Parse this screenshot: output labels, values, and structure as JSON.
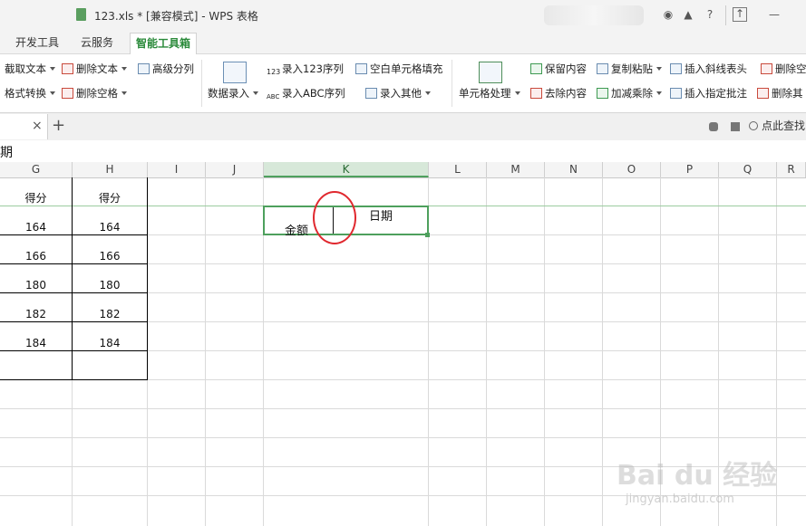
{
  "window": {
    "title": "123.xls * [兼容模式] - WPS 表格",
    "controls": [
      "?"
    ]
  },
  "ribbon_tabs": [
    {
      "label": "开发工具"
    },
    {
      "label": "云服务"
    },
    {
      "label": "智能工具箱",
      "active": true
    }
  ],
  "ribbon": {
    "extract_text": "截取文本",
    "delete_text": "删除文本",
    "advanced_split": "高级分列",
    "format_convert": "格式转换",
    "delete_spaces": "删除空格",
    "data_entry": "数据录入",
    "enter_123_seq": "录入123序列",
    "enter_abc_seq": "录入ABC序列",
    "blank_fill": "空白单元格填充",
    "enter_other": "录入其他",
    "cell_processing": "单元格处理",
    "keep_content": "保留内容",
    "remove_content": "去除内容",
    "copy_paste": "复制粘贴",
    "add_sub_mul_div": "加减乘除",
    "insert_diagonal_header": "插入斜线表头",
    "insert_specified_comment": "插入指定批注",
    "delete_empty": "删除空",
    "delete_other": "删除其"
  },
  "doctabs": {
    "add": "+",
    "close": "×",
    "search": "点此查找"
  },
  "formula_bar": {
    "content": "期"
  },
  "columns": [
    "G",
    "H",
    "I",
    "J",
    "K",
    "L",
    "M",
    "N",
    "O",
    "P",
    "Q",
    "R"
  ],
  "table": {
    "header": [
      "得分",
      "得分"
    ],
    "rows": [
      [
        "164",
        "164"
      ],
      [
        "166",
        "166"
      ],
      [
        "180",
        "180"
      ],
      [
        "182",
        "182"
      ],
      [
        "184",
        "184"
      ],
      [
        "",
        ""
      ]
    ]
  },
  "active_cell": {
    "top_right": "日期",
    "bottom_left": "金额"
  },
  "watermark": {
    "logo": "Bai du 经验",
    "url": "jingyan.baidu.com"
  },
  "colors": {
    "accent_green": "#4ea05d",
    "annotation_red": "#e0282e"
  }
}
